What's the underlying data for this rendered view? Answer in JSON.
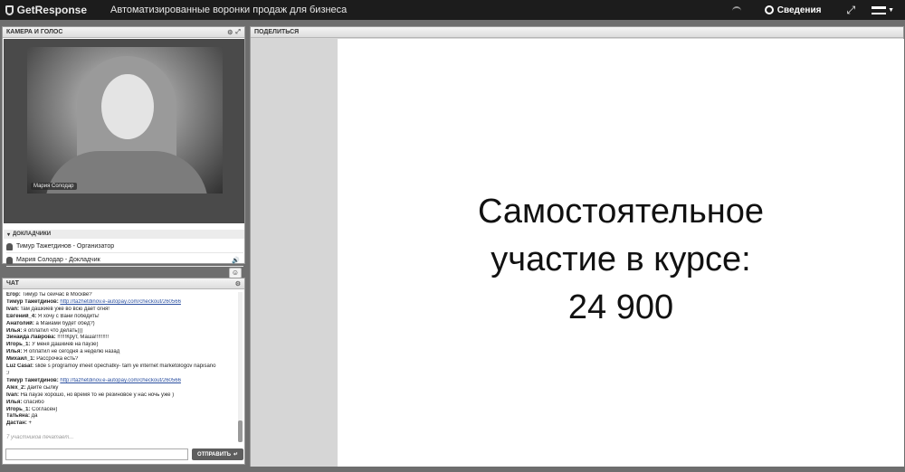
{
  "topbar": {
    "brand": "GetResponse",
    "title": "Автоматизированные воронки продаж для бизнеса",
    "info_label": "Сведения"
  },
  "camera_panel": {
    "title": "КАМЕРА И ГОЛОС",
    "video_name": "Мария Солодар",
    "speakers_title": "ДОКЛАДЧИКИ",
    "speakers": [
      "Тимур Тажетдинов - Организатор",
      "Мария Солодар - Докладчик"
    ]
  },
  "chat_panel": {
    "title": "ЧАТ",
    "messages": [
      {
        "author": "Егор:",
        "text": "Тимур ты сейчас в Москве?"
      },
      {
        "author": "Тимур Тажетдинов:",
        "text": "http://tazhetdinov.e-autopay.com/checkout/260566",
        "link": true
      },
      {
        "author": "Ivan:",
        "text": "там дашкиев уже во всю дает огня!"
      },
      {
        "author": "Евгений_4:",
        "text": "Я хочу с Вани  победить!"
      },
      {
        "author": "Анатолий:",
        "text": "а Майами будет обед?)"
      },
      {
        "author": "Илья:",
        "text": "я оплатил что делать)))"
      },
      {
        "author": "Зинаида Лаврова:",
        "text": "!!!!!!Крут, Маша!!!!!!!!!"
      },
      {
        "author": "Игорь_1:",
        "text": "У меня Дашкиев на паузе)"
      },
      {
        "author": "Илья:",
        "text": "Я оплатил не сегодня а неделю назад"
      },
      {
        "author": "Михаил_1:",
        "text": "Рассрочка есть?"
      },
      {
        "author": "Luz Casal:",
        "text": "slide s programoy imeet opechatky- tam ye internet marketologov napisano"
      },
      {
        "author": "",
        "text": ":/"
      },
      {
        "author": "Тимур Тажетдинов:",
        "text": "http://tazhetdinov.e-autopay.com/checkout/260566",
        "link": true
      },
      {
        "author": "Alex_2:",
        "text": "дайте сылку"
      },
      {
        "author": "Ivan:",
        "text": "На паузе хорошо, но время то не резиновое у нас ночь уже )"
      },
      {
        "author": "Илья:",
        "text": "спасибо"
      },
      {
        "author": "Игорь_1:",
        "text": "Согласен)"
      },
      {
        "author": "Татьяна:",
        "text": "да"
      },
      {
        "author": "Дастан:",
        "text": "+"
      }
    ],
    "typing": "7 участников печатает...",
    "input_value": "",
    "send_label": "ОТПРАВИТЬ"
  },
  "share_panel": {
    "title": "ПОДЕЛИТЬСЯ",
    "slide_line1": "Самостоятельное",
    "slide_line2": "участие в курсе:",
    "slide_line3": "24 900"
  }
}
